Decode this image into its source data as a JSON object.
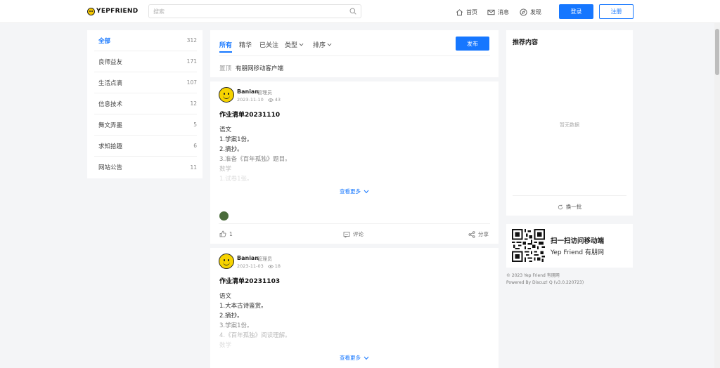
{
  "header": {
    "logo_text": "YEPFRIEND",
    "search_placeholder": "搜索",
    "nav": [
      {
        "label": "首页",
        "icon": "home-icon"
      },
      {
        "label": "消息",
        "icon": "mail-icon"
      },
      {
        "label": "发现",
        "icon": "compass-icon"
      }
    ],
    "login_label": "登录",
    "register_label": "注册"
  },
  "sidebar": {
    "categories": [
      {
        "label": "全部",
        "count": "312"
      },
      {
        "label": "良师益友",
        "count": "171"
      },
      {
        "label": "生活点滴",
        "count": "107"
      },
      {
        "label": "信息技术",
        "count": "12"
      },
      {
        "label": "舞文弄墨",
        "count": "5"
      },
      {
        "label": "求知拾趣",
        "count": "6"
      },
      {
        "label": "网站公告",
        "count": "11"
      }
    ]
  },
  "feed": {
    "tabs": [
      {
        "label": "所有"
      },
      {
        "label": "精华"
      },
      {
        "label": "已关注"
      },
      {
        "label": "类型"
      },
      {
        "label": "排序"
      }
    ],
    "publish_label": "发布",
    "pinned_tag": "置顶",
    "pinned_title": "有朋网移动客户端"
  },
  "posts": [
    {
      "author": "Banian",
      "role": "管理员",
      "date": "2023-11-10",
      "views": "43",
      "title": "作业清单20231110",
      "lines": [
        "语文",
        "1.学案1份。",
        "2.摘抄。",
        "3.准备《百年孤独》题目。",
        "数学",
        "1.试卷1张。"
      ],
      "see_more": "查看更多",
      "likes": "1",
      "comment_label": "评论",
      "share_label": "分享"
    },
    {
      "author": "Banian",
      "role": "管理员",
      "date": "2023-11-03",
      "views": "18",
      "title": "作业清单20231103",
      "lines": [
        "语文",
        "1.大本古诗鉴赏。",
        "2.摘抄。",
        "3.学案1份。",
        "4.《百年孤独》阅读理解。",
        "数学"
      ],
      "see_more": "查看更多"
    }
  ],
  "recommend": {
    "title": "推荐内容",
    "empty_text": "暂无数据",
    "refresh_label": "换一批"
  },
  "qr_card": {
    "title": "扫一扫访问移动端",
    "subtitle": "Yep Friend 有朋网"
  },
  "footer": {
    "line1": "© 2023 Yep Friend 有朋网",
    "line2": "Powered By Discuz! Q (v3.0.220723)"
  },
  "colors": {
    "accent": "#1677ff",
    "background": "#f4f5f7"
  }
}
